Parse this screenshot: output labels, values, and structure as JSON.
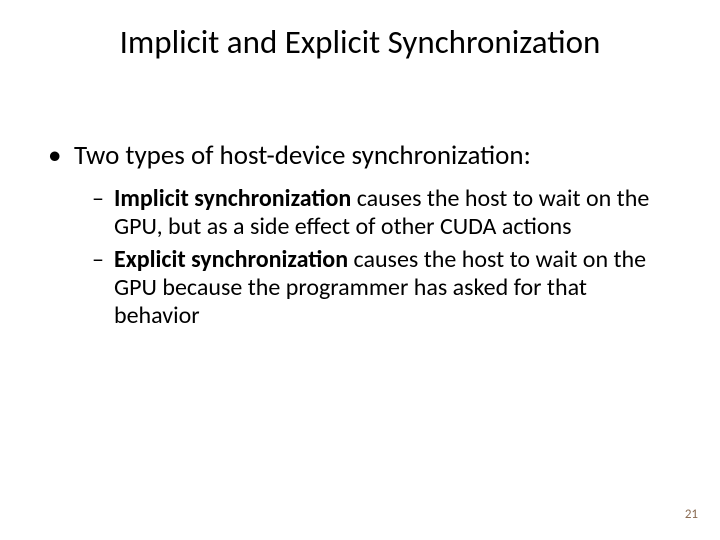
{
  "title": "Implicit and Explicit Synchronization",
  "bullets": {
    "main": "Two types of host-device synchronization:",
    "sub1_bold": "Implicit synchronization",
    "sub1_rest": " causes the host to wait on the GPU, but as a side effect of other CUDA actions",
    "sub2_bold": "Explicit synchronization",
    "sub2_rest": " causes the host to wait on the GPU because the programmer has asked for that behavior"
  },
  "page_number": "21"
}
